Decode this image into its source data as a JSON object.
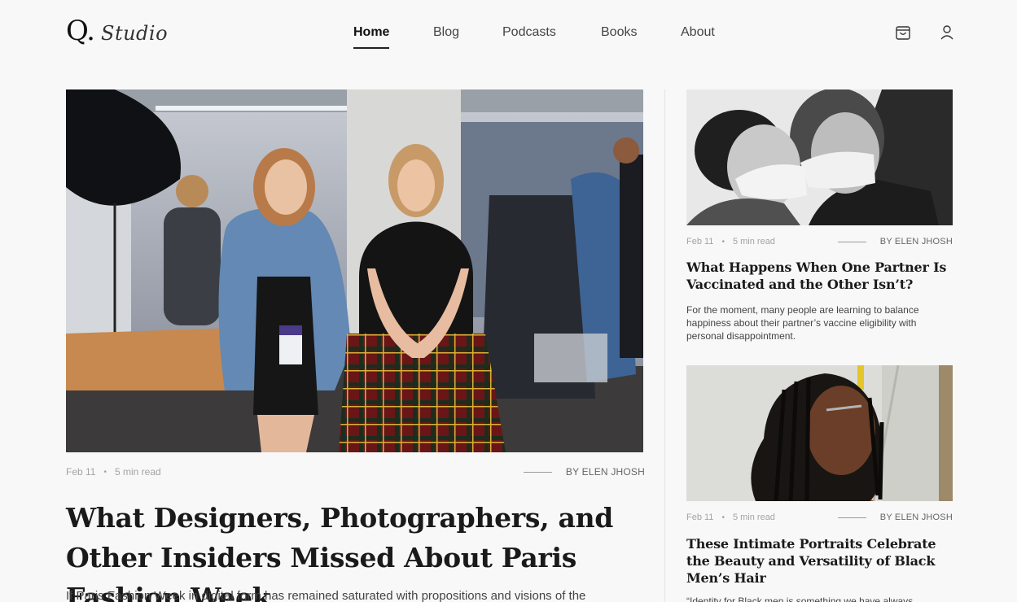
{
  "header": {
    "logo_letter": "Q.",
    "logo_script": "Studio",
    "nav": [
      "Home",
      "Blog",
      "Podcasts",
      "Books",
      "About"
    ],
    "active_nav": "Home"
  },
  "featured": {
    "date": "Feb 11",
    "read_time": "5 min read",
    "author": "BY ELEN JHOSH",
    "title": "What  Designers, Photographers, and Other Insiders Missed About Paris Fashion Week",
    "excerpt": "If Paris Fashion Week in digital form has remained saturated with propositions and visions of the"
  },
  "cards": [
    {
      "date": "Feb 11",
      "read_time": "5 min read",
      "author": "BY ELEN JHOSH",
      "title": "What Happens When One Partner Is Vaccinated and the Other Isn’t?",
      "excerpt": "For the moment, many people are learning to balance happiness about their partner’s vaccine eligibility with personal disappointment."
    },
    {
      "date": "Feb 11",
      "read_time": "5 min read",
      "author": "BY ELEN JHOSH",
      "title": "These Intimate Portraits Celebrate the Beauty and Versatility of Black Men’s Hair",
      "excerpt": "“Identity for Black men is something we have always"
    }
  ],
  "colors": {
    "background": "#f8f8f8",
    "text": "#1a1a1a",
    "muted": "#a3a3a3"
  },
  "icons": [
    "shopping-bag-icon",
    "user-icon"
  ]
}
